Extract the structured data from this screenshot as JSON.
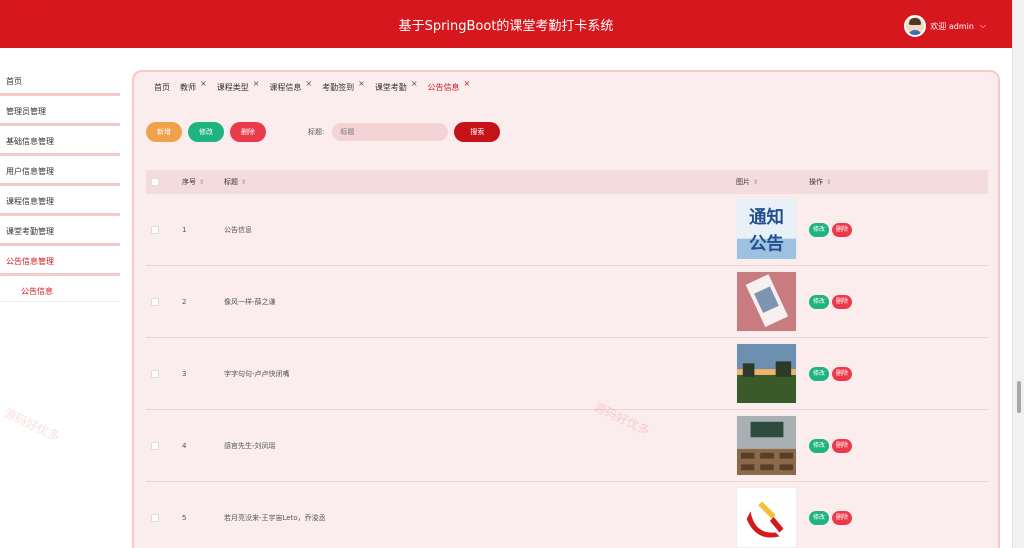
{
  "header": {
    "title": "基于SpringBoot的课堂考勤打卡系统",
    "user_label": "欢迎 admin"
  },
  "sidebar": {
    "items": [
      {
        "label": "首页"
      },
      {
        "label": "管理员管理"
      },
      {
        "label": "基础信息管理"
      },
      {
        "label": "用户信息管理"
      },
      {
        "label": "课程信息管理"
      },
      {
        "label": "课堂考勤管理"
      },
      {
        "label": "公告信息管理"
      }
    ],
    "sub_item": "公告信息"
  },
  "tabs": [
    "首页",
    "教师",
    "课程类型",
    "课程信息",
    "考勤签到",
    "课堂考勤",
    "公告信息"
  ],
  "toolbar": {
    "add_label": "新增",
    "edit_label": "修改",
    "delete_label": "删除",
    "search_label": "标题:",
    "search_placeholder": "标题",
    "search_button": "搜索"
  },
  "table": {
    "headers": {
      "index": "序号",
      "title": "标题",
      "image": "图片",
      "ops": "操作"
    },
    "rows": [
      {
        "index": "1",
        "title": "公告信息"
      },
      {
        "index": "2",
        "title": "像风一样-薛之谦"
      },
      {
        "index": "3",
        "title": "字字句句-卢卢快闭嘴"
      },
      {
        "index": "4",
        "title": "感官先生-刘凤瑶"
      },
      {
        "index": "5",
        "title": "若月亮没来-王宇宙Leto，乔浚丞"
      }
    ],
    "op_edit": "修改",
    "op_delete": "删除"
  },
  "image_overlay": {
    "notice_text_1": "通知",
    "notice_text_2": "公告"
  },
  "watermark": "源码好优多",
  "colors": {
    "brand": "#d7171e",
    "add": "#f0a24a",
    "edit": "#1fb382",
    "delete": "#eb3b4a"
  }
}
